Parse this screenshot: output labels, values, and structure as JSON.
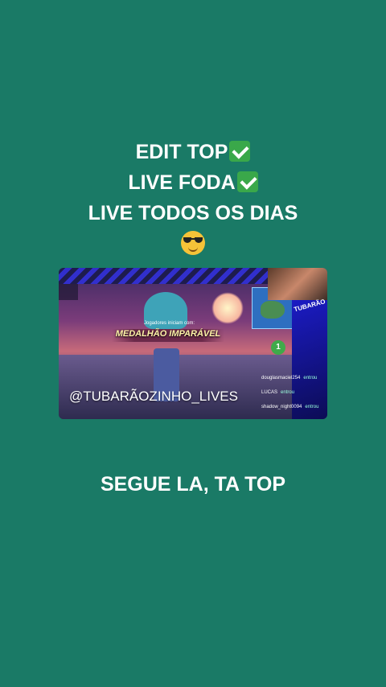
{
  "caption": {
    "line1": "EDIT TOP",
    "line2": "LIVE FODA",
    "line3": "LIVE TODOS OS DIAS"
  },
  "icons": {
    "check": "check-mark-emoji",
    "smile": "sunglasses-face-emoji"
  },
  "video": {
    "medal_text": "MEDALHÃO IMPARÁVEL",
    "hint_text": "Jogadores iniciam com:",
    "shield_value": "1",
    "logo_text": "TUBARÃO",
    "handle": "@TUBARÃOZINHO_LIVES",
    "chat": [
      {
        "user": "douglasmaciel254",
        "action": "entrou"
      },
      {
        "user": "LUCAS",
        "action": "entrou"
      },
      {
        "user": "shadow_night0094",
        "action": "entrou"
      }
    ]
  },
  "cta": "SEGUE LA, TA TOP",
  "colors": {
    "background": "#1a7a66",
    "text": "#ffffff"
  }
}
